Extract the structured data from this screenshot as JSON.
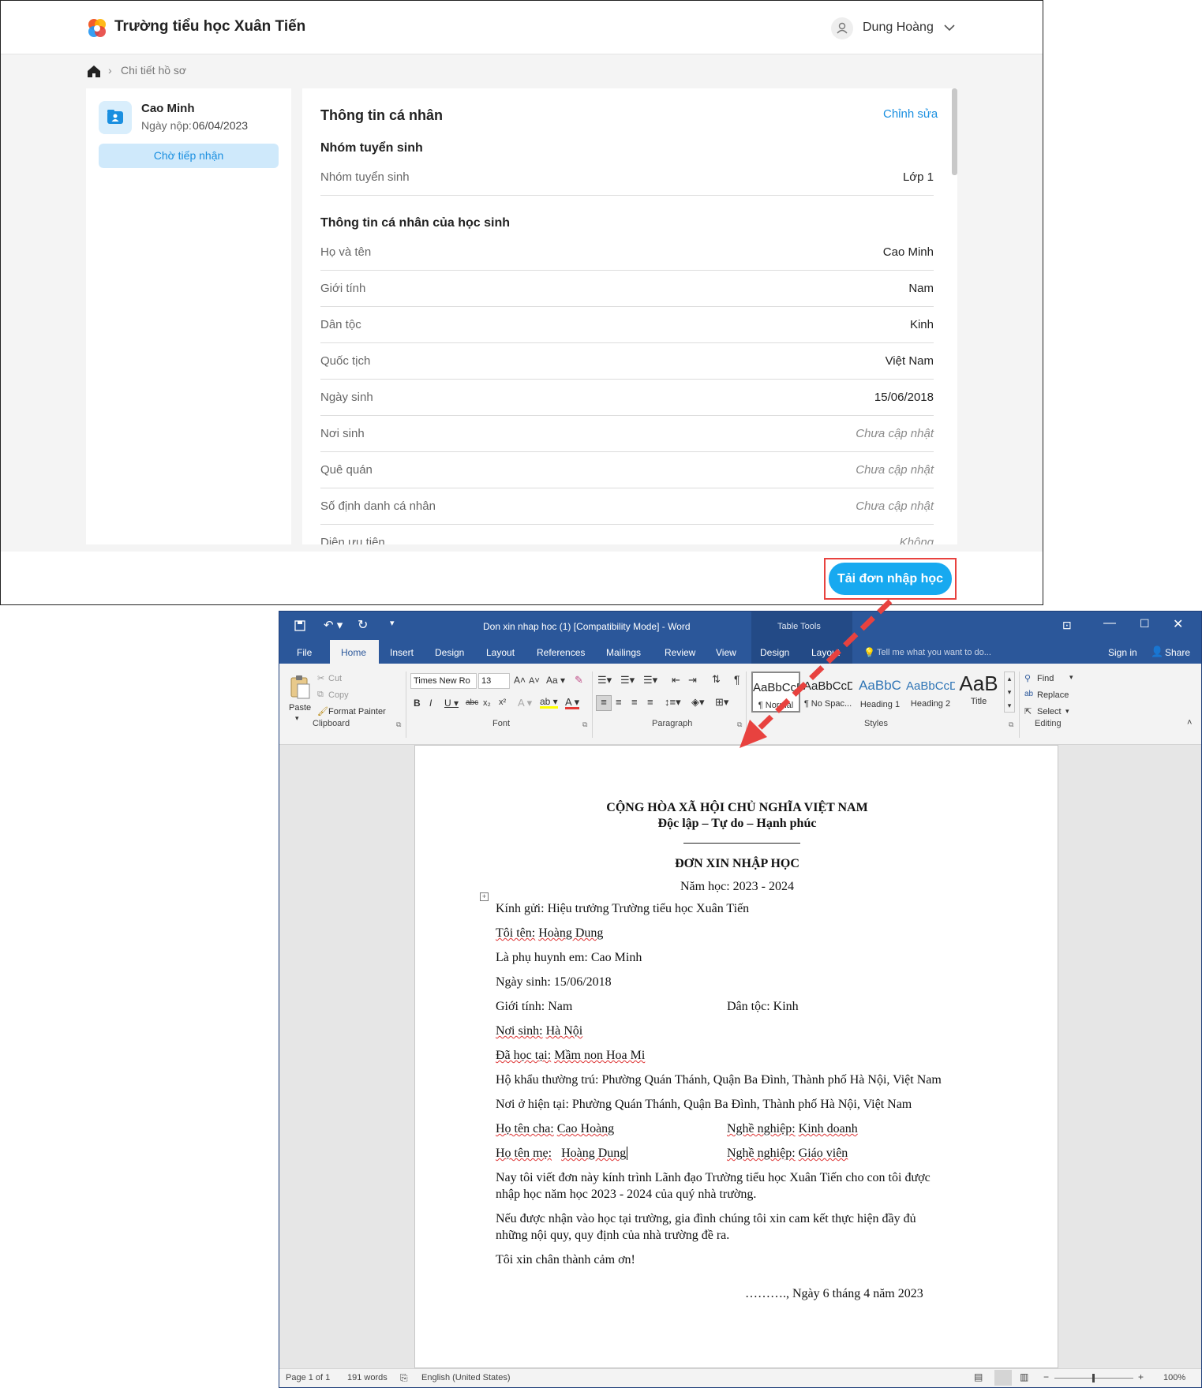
{
  "web": {
    "school_name": "Trường tiểu học Xuân Tiến",
    "user_name": "Dung Hoàng",
    "breadcrumb": "Chi tiết hồ sơ",
    "applicant": {
      "name": "Cao Minh",
      "submit_label": "Ngày nộp:",
      "submit_date": "06/04/2023",
      "status": "Chờ tiếp nhận"
    },
    "main": {
      "title": "Thông tin cá nhân",
      "edit": "Chỉnh sửa",
      "group_title": "Nhóm tuyển sinh",
      "group_rows": [
        {
          "label": "Nhóm tuyển sinh",
          "value": "Lớp 1"
        }
      ],
      "student_title": "Thông tin cá nhân của học sinh",
      "student_rows": [
        {
          "label": "Họ và tên",
          "value": "Cao Minh"
        },
        {
          "label": "Giới tính",
          "value": "Nam"
        },
        {
          "label": "Dân tộc",
          "value": "Kinh"
        },
        {
          "label": "Quốc tịch",
          "value": "Việt Nam"
        },
        {
          "label": "Ngày sinh",
          "value": "15/06/2018"
        },
        {
          "label": "Nơi sinh",
          "value": "Chưa cập nhật"
        },
        {
          "label": "Quê quán",
          "value": "Chưa cập nhật"
        },
        {
          "label": "Số định danh cá nhân",
          "value": "Chưa cập nhật"
        },
        {
          "label": "Diện ưu tiên",
          "value": "Không"
        }
      ]
    },
    "download_button": "Tải đơn nhập học"
  },
  "word": {
    "title": "Don xin nhap hoc (1) [Compatibility Mode] - Word",
    "table_tools": "Table Tools",
    "tabs": [
      "File",
      "Home",
      "Insert",
      "Design",
      "Layout",
      "References",
      "Mailings",
      "Review",
      "View",
      "Design",
      "Layout"
    ],
    "tell_me": "Tell me what you want to do...",
    "sign_in": "Sign in",
    "share": "Share",
    "clipboard": {
      "paste": "Paste",
      "cut": "Cut",
      "copy": "Copy",
      "format_painter": "Format Painter",
      "group": "Clipboard"
    },
    "font": {
      "name": "Times New Ro",
      "size": "13",
      "group": "Font"
    },
    "paragraph_group": "Paragraph",
    "styles": [
      {
        "preview": "AaBbCcDc",
        "name": "¶ Normal"
      },
      {
        "preview": "AaBbCcDc",
        "name": "¶ No Spac..."
      },
      {
        "preview": "AaBbC",
        "name": "Heading 1"
      },
      {
        "preview": "AaBbCcD",
        "name": "Heading 2"
      },
      {
        "preview": "AaB",
        "name": "Title"
      }
    ],
    "styles_group": "Styles",
    "editing": {
      "find": "Find",
      "replace": "Replace",
      "select": "Select",
      "group": "Editing"
    },
    "status": {
      "page": "Page 1 of 1",
      "words": "191 words",
      "language": "English (United States)",
      "zoom": "100%"
    },
    "doc": {
      "header1": "CỘNG HÒA XÃ HỘI CHỦ NGHĨA VIỆT NAM",
      "header2": "Độc lập – Tự do – Hạnh phúc",
      "title": "ĐƠN XIN NHẬP HỌC",
      "year": "Năm học: 2023 - 2024",
      "to": "Kính gửi: Hiệu trưởng Trường tiểu học Xuân Tiến",
      "me_label": "Tôi tên:",
      "me_value": "Hoàng Dung",
      "parent_of": "Là phụ huynh em: Cao Minh",
      "dob": "Ngày sinh: 15/06/2018",
      "gender": "Giới tính: Nam",
      "ethnic": "Dân tộc: Kinh",
      "birthplace_label": "Nơi sinh:",
      "birthplace_value": "Hà Nội",
      "school_label": "Đã học tại:",
      "school_value": "Mầm non Hoa Mi",
      "residence": "Hộ khẩu thường trú: Phường Quán Thánh, Quận Ba Đình, Thành phố Hà Nội, Việt Nam",
      "current": "Nơi ở hiện tại: Phường Quán Thánh, Quận Ba Đình, Thành phố Hà Nội, Việt Nam",
      "father_label": "Họ tên cha:",
      "father_value": "Cao Hoàng",
      "father_job_label": "Nghề nghiệp:",
      "father_job": "Kinh doanh",
      "mother_label": "Họ tên mẹ:",
      "mother_value": "Hoàng Dung",
      "mother_job_label": "Nghề nghiệp:",
      "mother_job": "Giáo viên",
      "para1_l1": "Nay tôi viết đơn này kính trình Lãnh đạo Trường tiểu học Xuân Tiến cho con tôi được",
      "para1_l2": "nhập học năm học 2023 - 2024 của quý nhà trường.",
      "para2_l1": "Nếu được nhận vào học tại trường, gia đình chúng tôi xin cam kết thực hiện đầy đủ",
      "para2_l2": "những nội quy, quy định của nhà trường đề ra.",
      "thanks": "Tôi xin chân thành cảm ơn!",
      "date_line": "………., Ngày 6 tháng 4 năm 2023"
    }
  },
  "colors": {
    "accent": "#17a9f0",
    "word_blue": "#2b579a",
    "highlight": "#e8423f"
  }
}
